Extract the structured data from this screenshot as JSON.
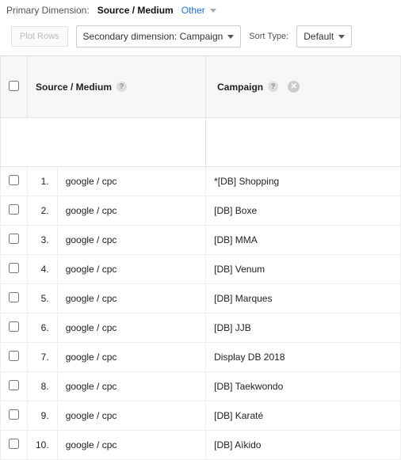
{
  "primary": {
    "label": "Primary Dimension:",
    "value": "Source / Medium",
    "other": "Other"
  },
  "controls": {
    "plot_rows": "Plot Rows",
    "secondary_dim": "Secondary dimension: Campaign",
    "sort_type_label": "Sort Type:",
    "sort_type_value": "Default"
  },
  "columns": {
    "source_medium": "Source / Medium",
    "campaign": "Campaign"
  },
  "rows": [
    {
      "n": "1.",
      "source": "google / cpc",
      "campaign": "*[DB] Shopping"
    },
    {
      "n": "2.",
      "source": "google / cpc",
      "campaign": "[DB] Boxe"
    },
    {
      "n": "3.",
      "source": "google / cpc",
      "campaign": "[DB] MMA"
    },
    {
      "n": "4.",
      "source": "google / cpc",
      "campaign": "[DB] Venum"
    },
    {
      "n": "5.",
      "source": "google / cpc",
      "campaign": "[DB] Marques"
    },
    {
      "n": "6.",
      "source": "google / cpc",
      "campaign": "[DB] JJB"
    },
    {
      "n": "7.",
      "source": "google / cpc",
      "campaign": "Display DB 2018"
    },
    {
      "n": "8.",
      "source": "google / cpc",
      "campaign": "[DB] Taekwondo"
    },
    {
      "n": "9.",
      "source": "google / cpc",
      "campaign": "[DB] Karaté"
    },
    {
      "n": "10.",
      "source": "google / cpc",
      "campaign": "[DB] Aïkido"
    }
  ]
}
